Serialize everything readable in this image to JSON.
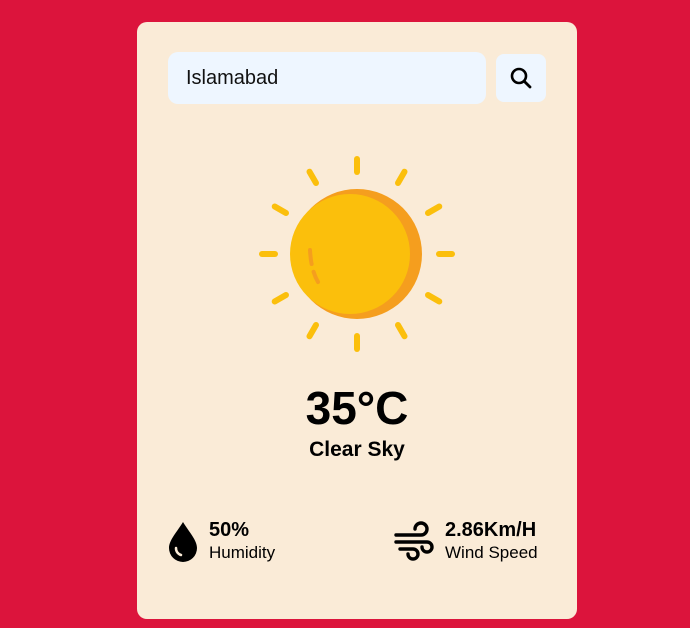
{
  "search": {
    "value": "Islamabad",
    "button_icon": "search-icon"
  },
  "weather": {
    "icon": "sun-icon",
    "temperature": "35°C",
    "condition": "Clear Sky"
  },
  "stats": {
    "humidity": {
      "value": "50%",
      "label": "Humidity",
      "icon": "water-drop-icon"
    },
    "wind": {
      "value": "2.86Km/H",
      "label": "Wind Speed",
      "icon": "wind-icon"
    }
  },
  "colors": {
    "background": "#dc143c",
    "card": "#faebd7",
    "input": "#eef6ff",
    "sun": "#fbbf0c",
    "sun_shade": "#f59e1e"
  }
}
